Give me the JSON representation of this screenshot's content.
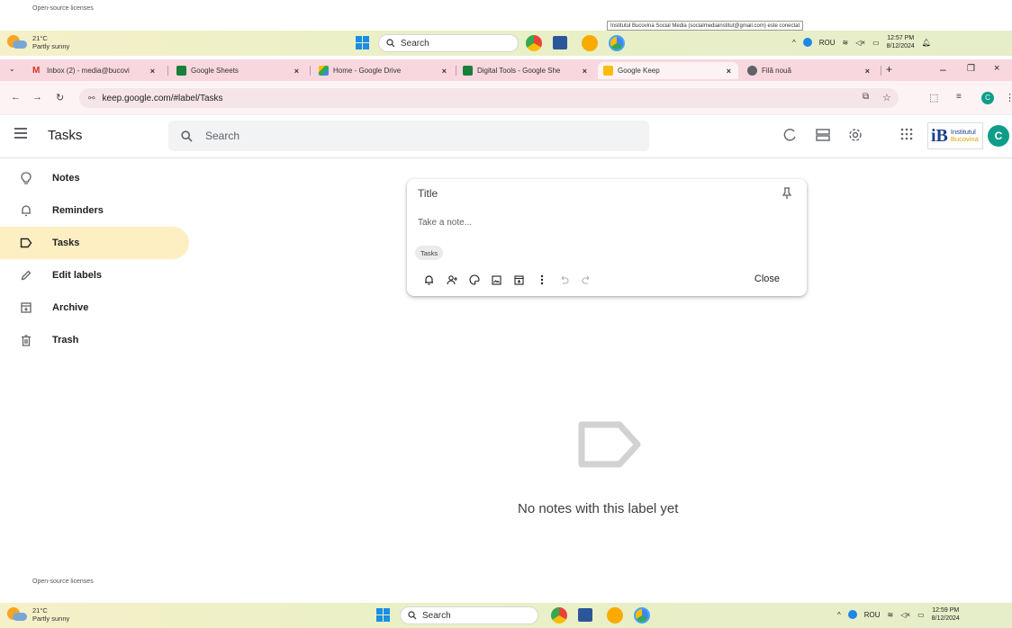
{
  "top_license": "Open-source licenses",
  "bottom_license": "Open-source licenses",
  "taskbar_top": {
    "temp": "21°C",
    "weather": "Partly sunny",
    "search_label": "Search",
    "tray_lang": "ROU",
    "time": "12:57 PM",
    "date": "8/12/2024"
  },
  "taskbar_bottom": {
    "temp": "21°C",
    "weather": "Partly sunny",
    "search_label": "Search",
    "tray_lang": "ROU",
    "time": "12:59 PM",
    "date": "8/12/2024"
  },
  "tooltip": "Institutul Bucovina Social Media (socialmediainstitut@gmail.com) este conectat",
  "tabs": [
    {
      "label": "Inbox (2) - media@bucovi",
      "favicon": "gmail-icon",
      "color": "#d93025"
    },
    {
      "label": "Google Sheets",
      "favicon": "sheets-icon",
      "color": "#188038"
    },
    {
      "label": "Home - Google Drive",
      "favicon": "drive-icon",
      "color": "#1a73e8"
    },
    {
      "label": "Digital Tools - Google She",
      "favicon": "sheets-icon",
      "color": "#188038"
    },
    {
      "label": "Google Keep",
      "favicon": "keep-icon",
      "color": "#fbbc04"
    },
    {
      "label": "Filă nouă",
      "favicon": "chrome-icon",
      "color": "#5f6368"
    }
  ],
  "new_tab": "+",
  "address": {
    "url": "keep.google.com/#label/Tasks"
  },
  "header": {
    "title": "Tasks",
    "search_placeholder": "Search",
    "brand_line1": "Institutul",
    "brand_line2": "Bucovina",
    "avatar_letter": "C"
  },
  "sidebar": {
    "items": [
      {
        "label": "Notes",
        "icon": "lightbulb-icon"
      },
      {
        "label": "Reminders",
        "icon": "bell-icon"
      },
      {
        "label": "Tasks",
        "icon": "label-icon",
        "active": true
      },
      {
        "label": "Edit labels",
        "icon": "pencil-icon"
      },
      {
        "label": "Archive",
        "icon": "archive-icon"
      },
      {
        "label": "Trash",
        "icon": "trash-icon"
      }
    ]
  },
  "note": {
    "title_placeholder": "Title",
    "body_placeholder": "Take a note...",
    "label_chip": "Tasks",
    "close_label": "Close"
  },
  "empty_state": {
    "message": "No notes with this label yet"
  },
  "colors": {
    "accent_active": "#feefc3",
    "tabstrip": "#f8d7de",
    "avatar": "#0f9d8a"
  }
}
